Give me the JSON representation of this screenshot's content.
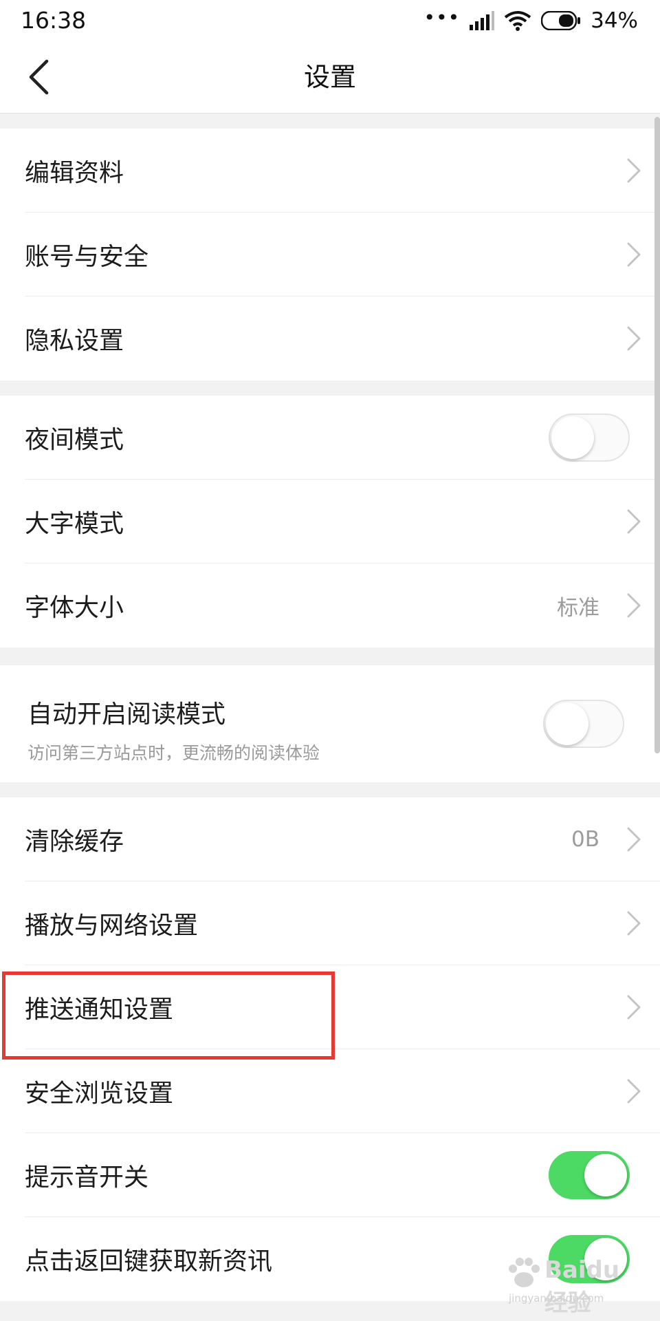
{
  "status_bar": {
    "time": "16:38",
    "dots": "•••",
    "battery": "34%"
  },
  "nav": {
    "title": "设置"
  },
  "groups": [
    {
      "items": [
        {
          "label": "编辑资料",
          "control": "chevron"
        },
        {
          "label": "账号与安全",
          "control": "chevron"
        },
        {
          "label": "隐私设置",
          "control": "chevron"
        }
      ]
    },
    {
      "items": [
        {
          "label": "夜间模式",
          "control": "toggle",
          "on": false
        },
        {
          "label": "大字模式",
          "control": "chevron"
        },
        {
          "label": "字体大小",
          "control": "chevron",
          "value": "标准"
        }
      ]
    },
    {
      "items": [
        {
          "label": "自动开启阅读模式",
          "subtitle": "访问第三方站点时，更流畅的阅读体验",
          "control": "toggle",
          "on": false
        }
      ]
    },
    {
      "items": [
        {
          "label": "清除缓存",
          "control": "chevron",
          "value": "0B"
        },
        {
          "label": "播放与网络设置",
          "control": "chevron"
        },
        {
          "label": "推送通知设置",
          "control": "chevron",
          "highlighted": true
        },
        {
          "label": "安全浏览设置",
          "control": "chevron"
        },
        {
          "label": "提示音开关",
          "control": "toggle",
          "on": true
        },
        {
          "label": "点击返回键获取新资讯",
          "control": "toggle",
          "on": true
        }
      ]
    }
  ],
  "watermark": {
    "brand": "Baidu经验",
    "url": "jingyan.baidu.com"
  },
  "colors": {
    "accent_on": "#4cd964",
    "highlight": "#e53935",
    "background": "#f2f2f2"
  }
}
